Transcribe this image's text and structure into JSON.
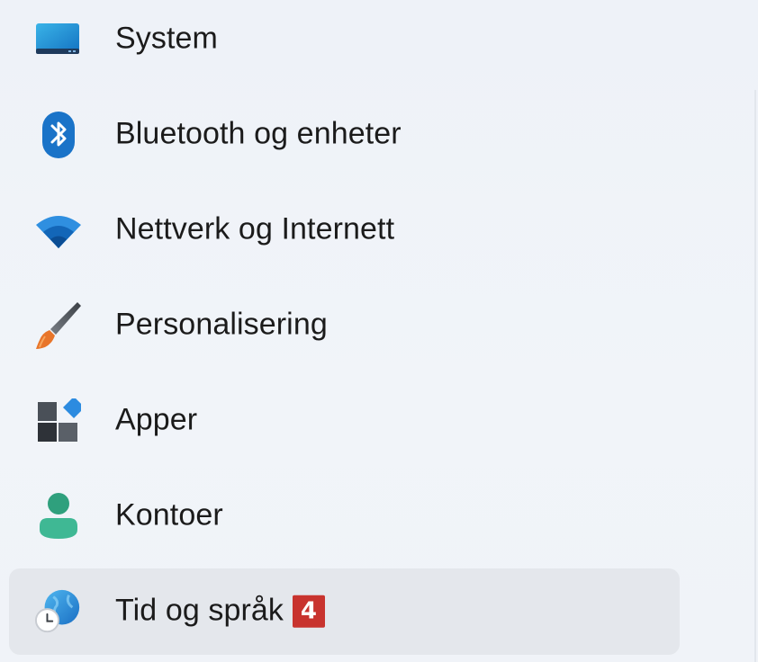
{
  "nav": {
    "items": [
      {
        "label": "System",
        "icon": "monitor-icon"
      },
      {
        "label": "Bluetooth og enheter",
        "icon": "bluetooth-icon"
      },
      {
        "label": "Nettverk og Internett",
        "icon": "wifi-icon"
      },
      {
        "label": "Personalisering",
        "icon": "paintbrush-icon"
      },
      {
        "label": "Apper",
        "icon": "apps-icon"
      },
      {
        "label": "Kontoer",
        "icon": "person-icon"
      },
      {
        "label": "Tid og språk",
        "icon": "globe-clock-icon",
        "selected": true,
        "badge": "4"
      }
    ]
  },
  "colors": {
    "background": "#f0f3f9",
    "selected_background": "#e4e7ec",
    "badge": "#c8332e",
    "accent": "#0f6cbd"
  }
}
